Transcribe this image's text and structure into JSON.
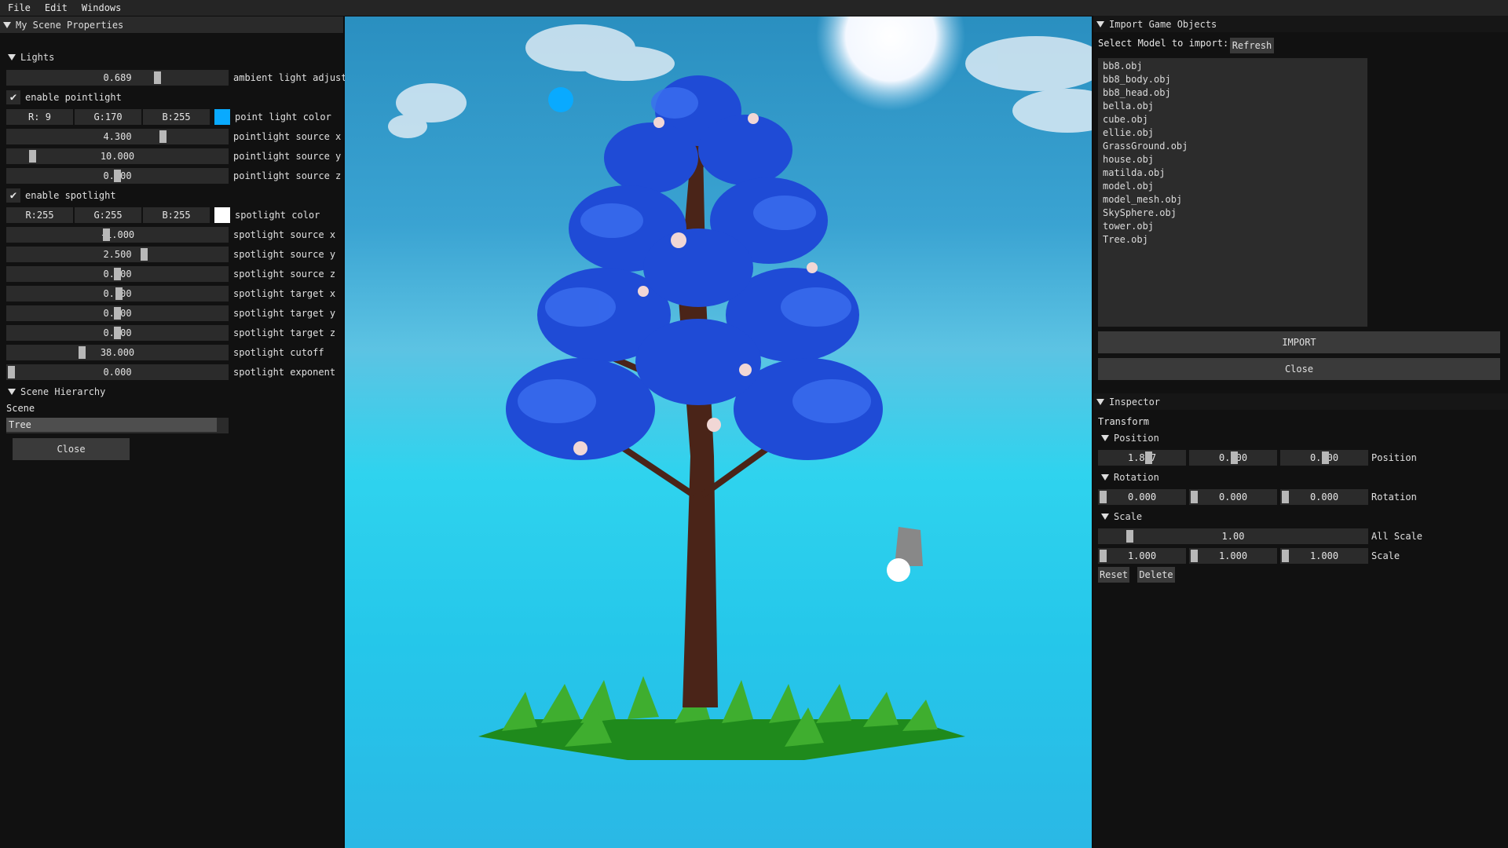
{
  "menu": [
    "File",
    "Edit",
    "Windows"
  ],
  "left_panel": {
    "title": "My Scene Properties",
    "lights_header": "Lights",
    "ambient": {
      "value": "0.689",
      "label": "ambient light adjust",
      "fraction": 0.689
    },
    "enable_pointlight": "enable pointlight",
    "point_color": {
      "r": "R:  9",
      "g": "G:170",
      "b": "B:255",
      "label": "point light color",
      "swatch": "#09aaff"
    },
    "point_x": {
      "value": "4.300",
      "label": "pointlight source x"
    },
    "point_y": {
      "value": "10.000",
      "label": "pointlight source y"
    },
    "point_z": {
      "value": "0.000",
      "label": "pointlight source z"
    },
    "enable_spotlight": "enable spotlight",
    "spot_color": {
      "r": "R:255",
      "g": "G:255",
      "b": "B:255",
      "label": "spotlight color",
      "swatch": "#ffffff"
    },
    "spot_src_x": {
      "value": "-1.000",
      "label": "spotlight source x"
    },
    "spot_src_y": {
      "value": "2.500",
      "label": "spotlight source y"
    },
    "spot_src_z": {
      "value": "0.000",
      "label": "spotlight source z"
    },
    "spot_tgt_x": {
      "value": "0.100",
      "label": "spotlight target x"
    },
    "spot_tgt_y": {
      "value": "0.000",
      "label": "spotlight target y"
    },
    "spot_tgt_z": {
      "value": "0.000",
      "label": "spotlight target z"
    },
    "spot_cutoff": {
      "value": "38.000",
      "label": "spotlight cutoff"
    },
    "spot_exponent": {
      "value": "0.000",
      "label": "spotlight exponent"
    },
    "hierarchy_header": "Scene Hierarchy",
    "scene_label": "Scene",
    "selected_object": "Tree",
    "close": "Close"
  },
  "import_panel": {
    "title": "Import Game Objects",
    "select_label": "Select Model to import:",
    "refresh": "Refresh",
    "models": [
      "bb8.obj",
      "bb8_body.obj",
      "bb8_head.obj",
      "bella.obj",
      "cube.obj",
      "ellie.obj",
      "GrassGround.obj",
      "house.obj",
      "matilda.obj",
      "model.obj",
      "model_mesh.obj",
      "SkySphere.obj",
      "tower.obj",
      "Tree.obj"
    ],
    "import_btn": "IMPORT",
    "close_btn": "Close"
  },
  "inspector": {
    "title": "Inspector",
    "transform": "Transform",
    "position_header": "Position",
    "position": [
      "1.807",
      "0.000",
      "0.000"
    ],
    "position_label": "Position",
    "rotation_header": "Rotation",
    "rotation": [
      "0.000",
      "0.000",
      "0.000"
    ],
    "rotation_label": "Rotation",
    "scale_header": "Scale",
    "all_scale": "1.00",
    "all_scale_label": "All Scale",
    "scale": [
      "1.000",
      "1.000",
      "1.000"
    ],
    "scale_label": "Scale",
    "reset": "Reset",
    "delete": "Delete"
  }
}
